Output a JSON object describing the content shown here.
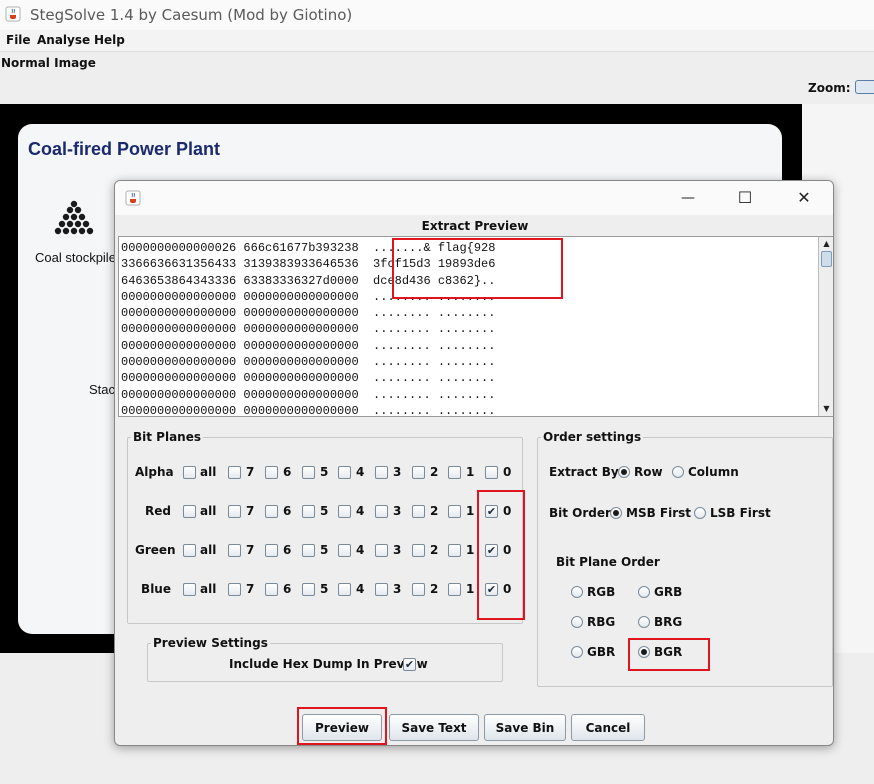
{
  "window": {
    "title": "StegSolve 1.4 by Caesum (Mod by Giotino)"
  },
  "menu": [
    {
      "label": "File"
    },
    {
      "label": "Analyse"
    },
    {
      "label": "Help"
    }
  ],
  "view": {
    "mode": "Normal Image",
    "zoom_label": "Zoom:"
  },
  "image": {
    "title": "Coal-fired Power Plant",
    "coal_label": "Coal stockpile",
    "stack_label": "Stac"
  },
  "dialog": {
    "close_glyph": "✕",
    "max_glyph": "☐",
    "min_glyph": "—",
    "extract_title": "Extract Preview",
    "preview_lines": [
      "0000000000000026 666c61677b393238  .......& flag{928",
      "3366636631356433 3139383933646536  3fcf15d3 19893de6",
      "6463653864343336 63383336327d0000  dce8d436 c8362}..",
      "0000000000000000 0000000000000000  ........ ........",
      "0000000000000000 0000000000000000  ........ ........",
      "0000000000000000 0000000000000000  ........ ........",
      "0000000000000000 0000000000000000  ........ ........",
      "0000000000000000 0000000000000000  ........ ........",
      "0000000000000000 0000000000000000  ........ ........",
      "0000000000000000 0000000000000000  ........ ........",
      "0000000000000000 0000000000000000  ........ ........"
    ],
    "bit_planes": {
      "legend": "Bit Planes",
      "all_label": "all",
      "bits": [
        "7",
        "6",
        "5",
        "4",
        "3",
        "2",
        "1",
        "0"
      ],
      "rows": [
        {
          "name": "Alpha",
          "all": false,
          "checked": [
            false,
            false,
            false,
            false,
            false,
            false,
            false,
            false
          ]
        },
        {
          "name": "Red",
          "all": false,
          "checked": [
            false,
            false,
            false,
            false,
            false,
            false,
            false,
            true
          ]
        },
        {
          "name": "Green",
          "all": false,
          "checked": [
            false,
            false,
            false,
            false,
            false,
            false,
            false,
            true
          ]
        },
        {
          "name": "Blue",
          "all": false,
          "checked": [
            false,
            false,
            false,
            false,
            false,
            false,
            false,
            true
          ]
        }
      ]
    },
    "preview_settings": {
      "legend": "Preview Settings",
      "hex_dump_label": "Include Hex Dump In Preview",
      "hex_dump": true
    },
    "order_settings": {
      "legend": "Order settings",
      "extract_by_label": "Extract By",
      "extract_by_options": [
        "Row",
        "Column"
      ],
      "extract_by_selected": "Row",
      "bit_order_label": "Bit Order",
      "bit_order_options": [
        "MSB First",
        "LSB First"
      ],
      "bit_order_selected": "MSB First",
      "plane_order_label": "Bit Plane Order",
      "plane_orders": [
        "RGB",
        "GRB",
        "RBG",
        "BRG",
        "GBR",
        "BGR"
      ],
      "plane_order_selected": "BGR"
    },
    "buttons": {
      "preview": "Preview",
      "save_text": "Save Text",
      "save_bin": "Save Bin",
      "cancel": "Cancel"
    }
  },
  "colors": {
    "highlight": "#e0141e",
    "title_blue": "#1a2a6c"
  }
}
